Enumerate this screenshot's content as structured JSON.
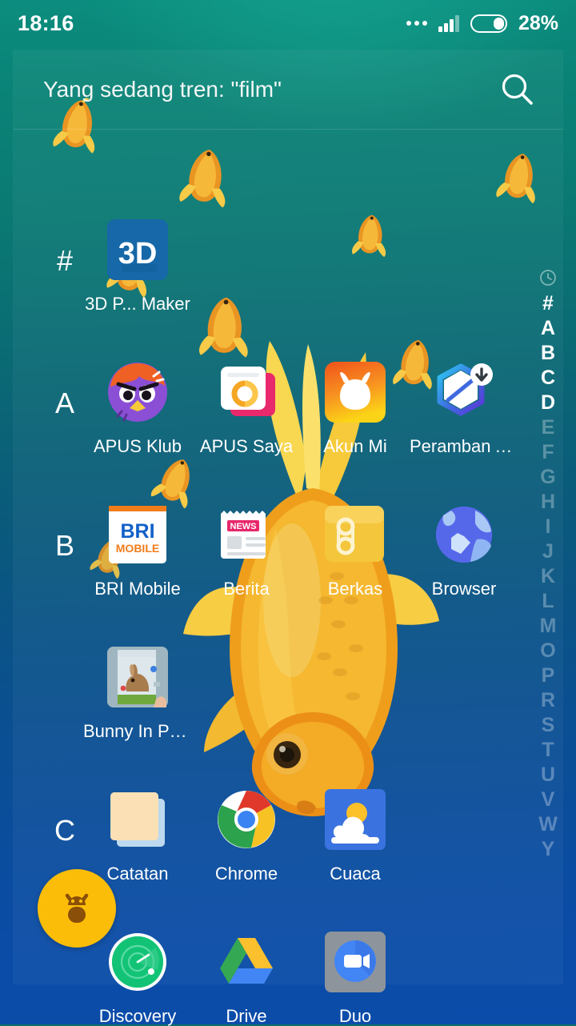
{
  "status_bar": {
    "time": "18:16",
    "battery_percent": "28%",
    "icons": [
      "more-dots-icon",
      "signal-bars-icon",
      "battery-icon"
    ]
  },
  "search": {
    "value": "Yang sedang tren: \"film\"",
    "placeholder": "Yang sedang tren: \"film\"",
    "icon": "search-icon"
  },
  "alpha_index": {
    "recent_icon": "clock-icon",
    "letters": [
      "#",
      "A",
      "B",
      "C",
      "D",
      "E",
      "F",
      "G",
      "H",
      "I",
      "J",
      "K",
      "L",
      "M",
      "O",
      "P",
      "R",
      "S",
      "T",
      "U",
      "V",
      "W",
      "Y"
    ],
    "active": [
      "#",
      "A",
      "B",
      "C",
      "D"
    ]
  },
  "sections": [
    {
      "letter": "#",
      "apps": [
        {
          "name": "3D P... Maker",
          "icon": "3d-maker-icon"
        }
      ]
    },
    {
      "letter": "A",
      "apps": [
        {
          "name": "APUS Klub",
          "icon": "apus-klub-icon"
        },
        {
          "name": "APUS Saya",
          "icon": "apus-saya-icon"
        },
        {
          "name": "Akun Mi",
          "icon": "mi-account-icon"
        },
        {
          "name": "Peramban A…",
          "icon": "peramban-icon"
        }
      ]
    },
    {
      "letter": "B",
      "apps": [
        {
          "name": "BRI Mobile",
          "icon": "bri-mobile-icon"
        },
        {
          "name": "Berita",
          "icon": "berita-news-icon"
        },
        {
          "name": "Berkas",
          "icon": "berkas-files-icon"
        },
        {
          "name": "Browser",
          "icon": "browser-globe-icon"
        }
      ]
    },
    {
      "letter": "",
      "apps": [
        {
          "name": "Bunny In Pho…",
          "icon": "bunny-photo-icon"
        }
      ]
    },
    {
      "letter": "C",
      "apps": [
        {
          "name": "Catatan",
          "icon": "catatan-notes-icon"
        },
        {
          "name": "Chrome",
          "icon": "chrome-icon"
        },
        {
          "name": "Cuaca",
          "icon": "cuaca-weather-icon"
        }
      ]
    },
    {
      "letter": "",
      "apps": [
        {
          "name": "Discovery",
          "icon": "discovery-radar-icon"
        },
        {
          "name": "Drive",
          "icon": "google-drive-icon"
        },
        {
          "name": "Duo",
          "icon": "google-duo-icon"
        }
      ]
    }
  ],
  "floating_bubble": {
    "icon": "android-bug-icon"
  },
  "colors": {
    "bg_top": "#0b8d7e",
    "bg_bottom": "#0b4caa",
    "accent_text": "#ffffff",
    "index_dim": "rgba(255,255,255,0.30)"
  }
}
